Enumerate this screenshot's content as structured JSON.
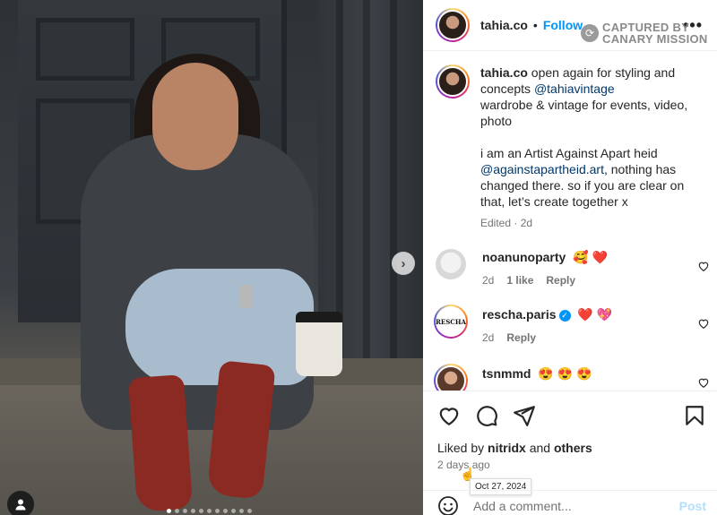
{
  "header": {
    "username": "tahia.co",
    "separator": "•",
    "follow_label": "Follow",
    "more_icon": "more-horizontal-icon"
  },
  "watermark": {
    "line1": "CAPTURED BY",
    "line2": "CANARY MISSION"
  },
  "caption": {
    "username": "tahia.co",
    "text_1": "open again for styling and concepts",
    "mention_1": "@tahiavintage",
    "text_2": "wardrobe & vintage for events, video, photo",
    "text_3": "i am an Artist Against Apart heid",
    "mention_2": "@againstapartheid.art",
    "text_4": ", nothing has changed there. so if you are clear on that, let’s create together x",
    "meta": "Edited · 2d"
  },
  "comments": [
    {
      "username": "noanunoparty",
      "emoji": "🥰 ❤️",
      "time": "2d",
      "likes": "1 like",
      "reply": "Reply"
    },
    {
      "username": "rescha.paris",
      "emoji": "❤️ 💖",
      "time": "2d",
      "reply": "Reply",
      "verified": true,
      "avatar_text": "RESCHA"
    },
    {
      "username": "tsnmmd",
      "emoji": "😍 😍 😍"
    }
  ],
  "actions": {
    "liked_prefix": "Liked by",
    "liked_user": "nitridx",
    "liked_and": "and",
    "liked_others": "others",
    "post_time": "2 days ago",
    "tooltip": "Oct 27, 2024"
  },
  "add_comment": {
    "placeholder": "Add a comment...",
    "post_label": "Post"
  },
  "carousel": {
    "total_slides": 11,
    "active_index": 0
  },
  "colors": {
    "accent": "#0095f6",
    "mention": "#00376b",
    "muted": "#737373"
  }
}
